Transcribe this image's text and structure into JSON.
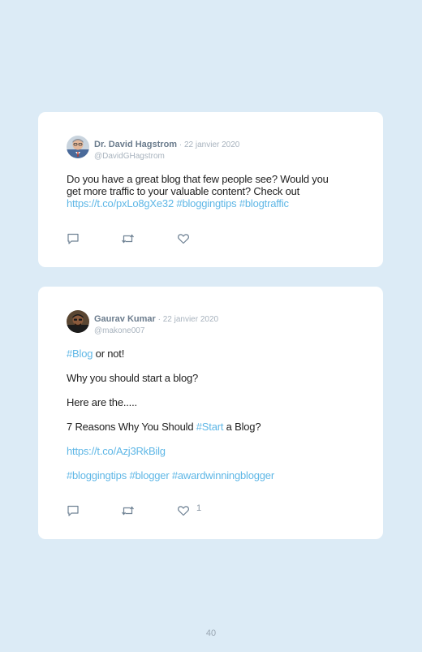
{
  "tweets": [
    {
      "author": "Dr. David Hagstrom",
      "sep": " · ",
      "date": "22 janvier 2020",
      "handle": "@DavidGHagstrom",
      "text_line1": "Do you have a great blog that few people see? Would you",
      "text_line2": "get more traffic to your valuable content? Check out",
      "link": "https://t.co/pxLo8gXe32",
      "tag1": "#bloggingtips",
      "tag2": "#blogtraffic"
    },
    {
      "author": "Gaurav Kumar",
      "sep": " · ",
      "date": "22 janvier 2020",
      "handle": "@makone007",
      "p1_tag": "#Blog",
      "p1_rest": " or not!",
      "p2": "Why you should start a blog?",
      "p3": "Here are the.....",
      "p4_pre": "7 Reasons Why You Should ",
      "p4_tag": "#Start",
      "p4_post": " a Blog?",
      "p5_link": "https://t.co/Azj3RkBilg",
      "p6_tag1": "#bloggingtips",
      "p6_tag2": "#blogger",
      "p6_tag3": "#awardwinningblogger",
      "like_count": "1"
    }
  ],
  "page_number": "40",
  "colors": {
    "background": "#dcebf6",
    "card": "#ffffff",
    "link": "#5fb7e6",
    "icon": "#6f8294"
  },
  "icons": [
    "reply-icon",
    "retweet-icon",
    "like-icon"
  ]
}
